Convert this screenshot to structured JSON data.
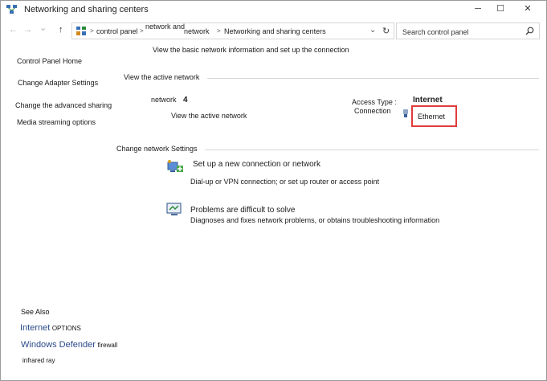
{
  "window": {
    "title": "Networking and sharing centers",
    "minimize": "─",
    "maximize": "☐",
    "close": "✕"
  },
  "nav": {
    "back": "←",
    "forward": "→",
    "dropdown": "⌄",
    "up": "↑",
    "breadcrumbs": [
      "control panel",
      "network and",
      "network",
      "Networking and sharing centers"
    ],
    "separator": ">",
    "refresh": "↻",
    "search_placeholder": "Search control panel"
  },
  "left_pane": {
    "links": [
      "Control Panel Home",
      "Change Adapter Settings",
      "Change the advanced sharing",
      "Media streaming options"
    ],
    "see_also_heading": "See Also",
    "see_also": [
      {
        "big": "Internet",
        "small": "OPTIONS"
      },
      {
        "big": "Windows Defender",
        "small": "firewall"
      },
      {
        "big": "",
        "small": "infrared ray"
      }
    ]
  },
  "main": {
    "header": "View the basic network information and set up the connection",
    "active_heading": "View the active network",
    "network_label": "network",
    "network_number": "4",
    "view_active_link": "View the active network",
    "access_type_label": "Access Type :",
    "access_type_value": "Internet",
    "connection_label": "Connection",
    "connection_value": "Ethernet",
    "change_heading": "Change network Settings",
    "tasks": [
      {
        "title": "Set up a new connection or network",
        "desc": "Dial-up or VPN connection; or set up router or access point"
      },
      {
        "title": "Problems are difficult to solve",
        "desc": "Diagnoses and fixes network problems, or obtains troubleshooting information"
      }
    ]
  },
  "colors": {
    "highlight_box": "#e03c3c",
    "see_also_link": "#2b4a8a"
  }
}
